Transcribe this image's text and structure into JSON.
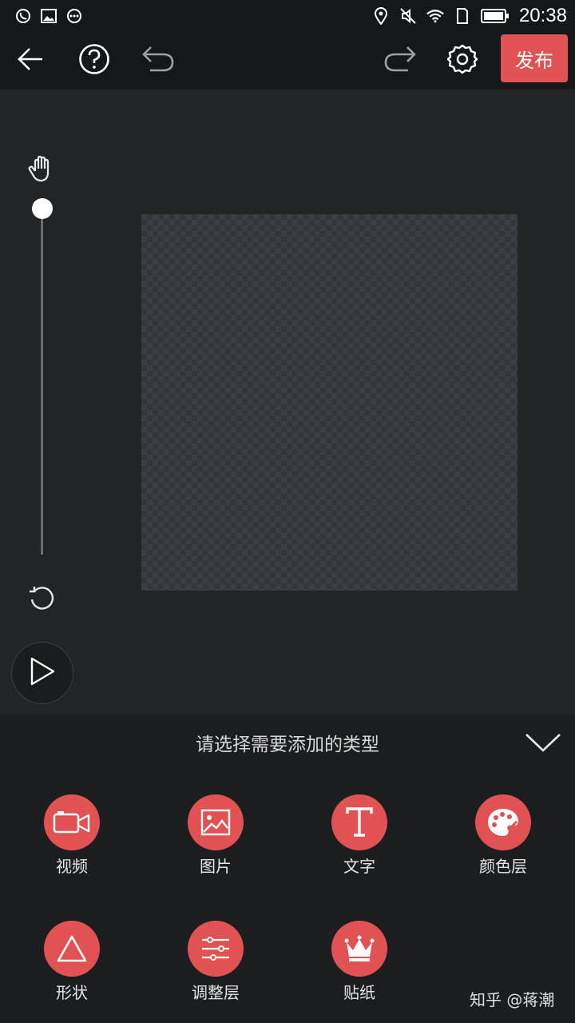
{
  "status_bar": {
    "time": "20:38"
  },
  "toolbar": {
    "publish_label": "发布"
  },
  "sheet": {
    "title": "请选择需要添加的类型",
    "items": [
      {
        "label": "视频",
        "icon": "video-camera-icon"
      },
      {
        "label": "图片",
        "icon": "image-icon"
      },
      {
        "label": "文字",
        "icon": "text-t-icon"
      },
      {
        "label": "颜色层",
        "icon": "palette-icon"
      },
      {
        "label": "形状",
        "icon": "triangle-icon"
      },
      {
        "label": "调整层",
        "icon": "sliders-icon"
      },
      {
        "label": "贴纸",
        "icon": "crown-icon"
      }
    ]
  },
  "watermark": "知乎 @蒋潮",
  "colors": {
    "accent": "#e05352",
    "bar_bg": "#15181a",
    "canvas_bg": "#222426"
  }
}
